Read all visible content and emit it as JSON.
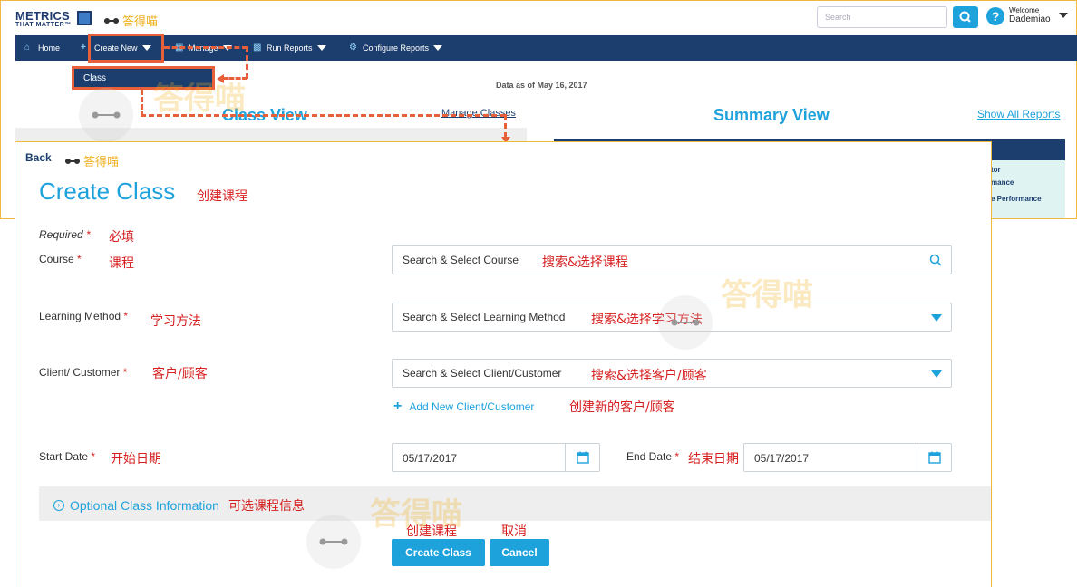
{
  "header": {
    "logo_line1": "METRICS",
    "logo_line2": "THAT MATTER™",
    "watermark": "答得喵",
    "search_placeholder": "Search",
    "welcome_label": "Welcome",
    "username": "Dademiao"
  },
  "nav": {
    "home": "Home",
    "create_new": "Create New",
    "manage": "Manage",
    "run_reports": "Run Reports",
    "configure_reports": "Configure Reports",
    "dropdown_item": "Class"
  },
  "background": {
    "data_as_of": "Data as of May 16, 2017",
    "class_view": "Class View",
    "manage_classes": "Manage Classes",
    "summary_view": "Summary View",
    "show_all_reports": "Show All Reports",
    "summary_lines": [
      "tor",
      "mance",
      "e Performance"
    ]
  },
  "form": {
    "back": "Back",
    "back_annotation": "答得喵",
    "title": "Create Class",
    "title_annotation": "创建课程",
    "required_label": "Required",
    "required_annotation": "必填",
    "course_label": "Course",
    "course_annotation": "课程",
    "course_placeholder": "Search & Select Course",
    "course_placeholder_annotation": "搜索&选择课程",
    "learning_method_label": "Learning Method",
    "learning_method_annotation": "学习方法",
    "learning_method_placeholder": "Search & Select Learning Method",
    "learning_method_placeholder_annotation": "搜索&选择学习方法",
    "client_label": "Client/ Customer",
    "client_annotation": "客户/顾客",
    "client_placeholder": "Search & Select Client/Customer",
    "client_placeholder_annotation": "搜索&选择客户/顾客",
    "add_client": "Add New Client/Customer",
    "add_client_annotation": "创建新的客户/顾客",
    "start_date_label": "Start Date",
    "start_date_annotation": "开始日期",
    "start_date_value": "05/17/2017",
    "end_date_label": "End Date",
    "end_date_annotation": "结束日期",
    "end_date_value": "05/17/2017",
    "optional_info": "Optional Class Information",
    "optional_info_annotation": "可选课程信息",
    "create_button": "Create Class",
    "create_button_annotation": "创建课程",
    "cancel_button": "Cancel",
    "cancel_button_annotation": "取消",
    "required_mark": "*"
  },
  "colors": {
    "accent": "#1ea2dc",
    "navy": "#1c3e6e",
    "highlight": "#e8603a",
    "annotation": "#d62020",
    "watermark": "#f0b020"
  }
}
